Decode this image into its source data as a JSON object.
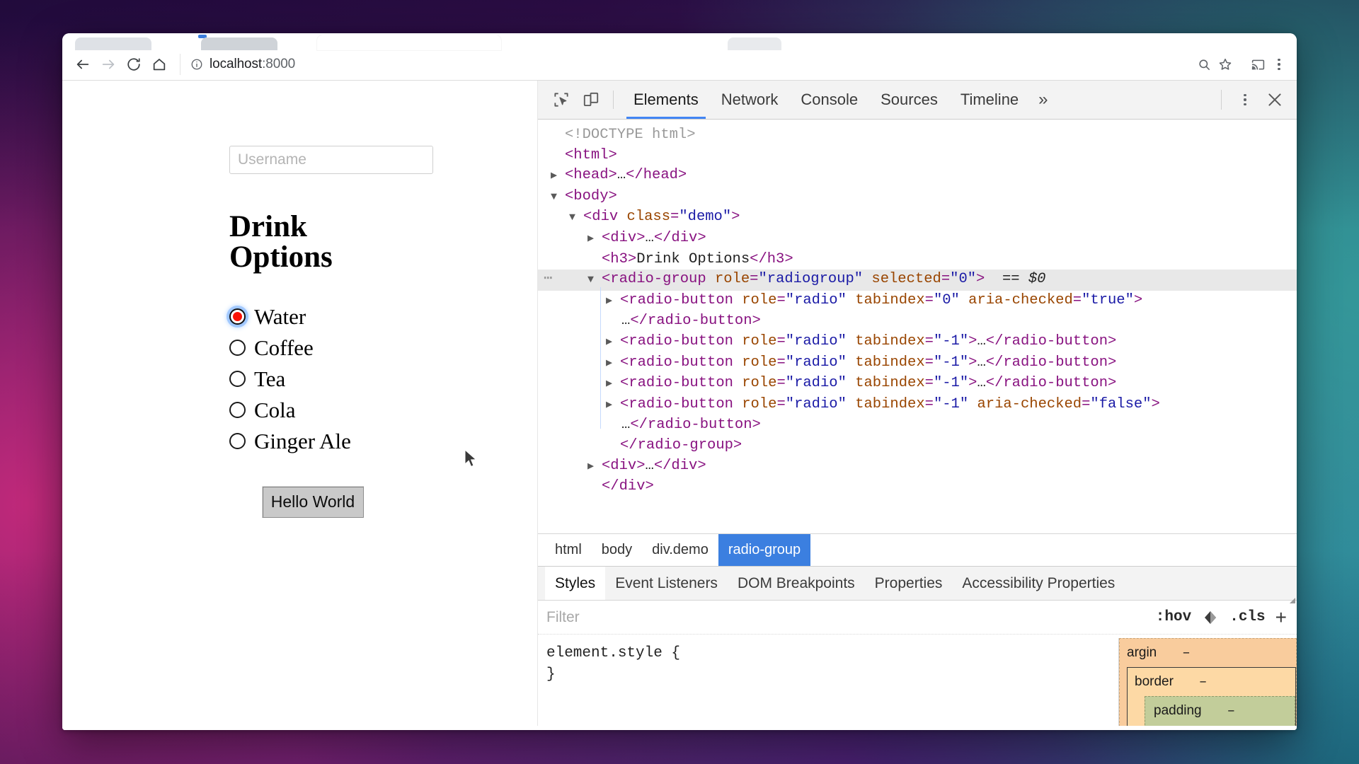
{
  "browser": {
    "url_host": "localhost",
    "url_port": ":8000",
    "back_icon": "back-arrow-icon",
    "forward_icon": "forward-arrow-icon",
    "reload_icon": "reload-icon",
    "home_icon": "home-icon",
    "info_icon": "site-info-icon",
    "zoom_icon": "zoom-icon",
    "star_icon": "bookmark-star-icon",
    "cast_icon": "cast-icon",
    "menu_icon": "browser-menu-icon"
  },
  "page": {
    "username_placeholder": "Username",
    "heading": "Drink Options",
    "options": [
      {
        "label": "Water",
        "selected": true
      },
      {
        "label": "Coffee",
        "selected": false
      },
      {
        "label": "Tea",
        "selected": false
      },
      {
        "label": "Cola",
        "selected": false
      },
      {
        "label": "Ginger Ale",
        "selected": false
      }
    ],
    "button_label": "Hello World"
  },
  "devtools": {
    "inspect_icon": "inspect-element-icon",
    "device_icon": "device-toolbar-icon",
    "tabs": [
      {
        "label": "Elements",
        "active": true
      },
      {
        "label": "Network",
        "active": false
      },
      {
        "label": "Console",
        "active": false
      },
      {
        "label": "Sources",
        "active": false
      },
      {
        "label": "Timeline",
        "active": false
      }
    ],
    "more_tabs_label": "»",
    "kebab_icon": "devtools-menu-icon",
    "close_icon": "close-devtools-icon",
    "dom": [
      {
        "indent": 0,
        "twisty": "none",
        "dots": false,
        "hl": false,
        "parts": [
          {
            "t": "doctype",
            "s": "<!DOCTYPE html>"
          }
        ]
      },
      {
        "indent": 0,
        "twisty": "none",
        "dots": false,
        "hl": false,
        "parts": [
          {
            "t": "tag",
            "s": "<html>"
          }
        ]
      },
      {
        "indent": 0,
        "twisty": "closed",
        "dots": false,
        "hl": false,
        "parts": [
          {
            "t": "tag",
            "s": "<head>"
          },
          {
            "t": "txt",
            "s": "…"
          },
          {
            "t": "tag",
            "s": "</head>"
          }
        ]
      },
      {
        "indent": 0,
        "twisty": "open",
        "dots": false,
        "hl": false,
        "parts": [
          {
            "t": "tag",
            "s": "<body>"
          }
        ]
      },
      {
        "indent": 1,
        "twisty": "open",
        "dots": false,
        "hl": false,
        "parts": [
          {
            "t": "tag",
            "s": "<div "
          },
          {
            "t": "attr",
            "s": "class"
          },
          {
            "t": "tag",
            "s": "="
          },
          {
            "t": "val",
            "s": "\"demo\""
          },
          {
            "t": "tag",
            "s": ">"
          }
        ]
      },
      {
        "indent": 2,
        "twisty": "closed",
        "dots": false,
        "hl": false,
        "parts": [
          {
            "t": "tag",
            "s": "<div>"
          },
          {
            "t": "txt",
            "s": "…"
          },
          {
            "t": "tag",
            "s": "</div>"
          }
        ]
      },
      {
        "indent": 2,
        "twisty": "none",
        "dots": false,
        "hl": false,
        "parts": [
          {
            "t": "tag",
            "s": "<h3>"
          },
          {
            "t": "txt",
            "s": "Drink Options"
          },
          {
            "t": "tag",
            "s": "</h3>"
          }
        ]
      },
      {
        "indent": 2,
        "twisty": "open",
        "dots": true,
        "hl": true,
        "parts": [
          {
            "t": "tag",
            "s": "<radio-group "
          },
          {
            "t": "attr",
            "s": "role"
          },
          {
            "t": "tag",
            "s": "="
          },
          {
            "t": "val",
            "s": "\"radiogroup\""
          },
          {
            "t": "tag",
            "s": " "
          },
          {
            "t": "attr",
            "s": "selected"
          },
          {
            "t": "tag",
            "s": "="
          },
          {
            "t": "val",
            "s": "\"0\""
          },
          {
            "t": "tag",
            "s": ">"
          },
          {
            "t": "txt",
            "s": "  == "
          },
          {
            "t": "dollar",
            "s": "$0"
          }
        ]
      },
      {
        "indent": 3,
        "twisty": "closed",
        "dots": false,
        "hl": false,
        "parts": [
          {
            "t": "tag",
            "s": "<radio-button "
          },
          {
            "t": "attr",
            "s": "role"
          },
          {
            "t": "tag",
            "s": "="
          },
          {
            "t": "val",
            "s": "\"radio\""
          },
          {
            "t": "tag",
            "s": " "
          },
          {
            "t": "attr",
            "s": "tabindex"
          },
          {
            "t": "tag",
            "s": "="
          },
          {
            "t": "val",
            "s": "\"0\""
          },
          {
            "t": "tag",
            "s": " "
          },
          {
            "t": "attr",
            "s": "aria-checked"
          },
          {
            "t": "tag",
            "s": "="
          },
          {
            "t": "val",
            "s": "\"true\""
          },
          {
            "t": "tag",
            "s": ">"
          }
        ]
      },
      {
        "indent": 3,
        "twisty": "none",
        "dots": false,
        "hl": false,
        "cont": true,
        "parts": [
          {
            "t": "txt",
            "s": "…"
          },
          {
            "t": "tag",
            "s": "</radio-button>"
          }
        ]
      },
      {
        "indent": 3,
        "twisty": "closed",
        "dots": false,
        "hl": false,
        "parts": [
          {
            "t": "tag",
            "s": "<radio-button "
          },
          {
            "t": "attr",
            "s": "role"
          },
          {
            "t": "tag",
            "s": "="
          },
          {
            "t": "val",
            "s": "\"radio\""
          },
          {
            "t": "tag",
            "s": " "
          },
          {
            "t": "attr",
            "s": "tabindex"
          },
          {
            "t": "tag",
            "s": "="
          },
          {
            "t": "val",
            "s": "\"-1\""
          },
          {
            "t": "tag",
            "s": ">"
          },
          {
            "t": "txt",
            "s": "…"
          },
          {
            "t": "tag",
            "s": "</radio-button>"
          }
        ]
      },
      {
        "indent": 3,
        "twisty": "closed",
        "dots": false,
        "hl": false,
        "parts": [
          {
            "t": "tag",
            "s": "<radio-button "
          },
          {
            "t": "attr",
            "s": "role"
          },
          {
            "t": "tag",
            "s": "="
          },
          {
            "t": "val",
            "s": "\"radio\""
          },
          {
            "t": "tag",
            "s": " "
          },
          {
            "t": "attr",
            "s": "tabindex"
          },
          {
            "t": "tag",
            "s": "="
          },
          {
            "t": "val",
            "s": "\"-1\""
          },
          {
            "t": "tag",
            "s": ">"
          },
          {
            "t": "txt",
            "s": "…"
          },
          {
            "t": "tag",
            "s": "</radio-button>"
          }
        ]
      },
      {
        "indent": 3,
        "twisty": "closed",
        "dots": false,
        "hl": false,
        "parts": [
          {
            "t": "tag",
            "s": "<radio-button "
          },
          {
            "t": "attr",
            "s": "role"
          },
          {
            "t": "tag",
            "s": "="
          },
          {
            "t": "val",
            "s": "\"radio\""
          },
          {
            "t": "tag",
            "s": " "
          },
          {
            "t": "attr",
            "s": "tabindex"
          },
          {
            "t": "tag",
            "s": "="
          },
          {
            "t": "val",
            "s": "\"-1\""
          },
          {
            "t": "tag",
            "s": ">"
          },
          {
            "t": "txt",
            "s": "…"
          },
          {
            "t": "tag",
            "s": "</radio-button>"
          }
        ]
      },
      {
        "indent": 3,
        "twisty": "closed",
        "dots": false,
        "hl": false,
        "parts": [
          {
            "t": "tag",
            "s": "<radio-button "
          },
          {
            "t": "attr",
            "s": "role"
          },
          {
            "t": "tag",
            "s": "="
          },
          {
            "t": "val",
            "s": "\"radio\""
          },
          {
            "t": "tag",
            "s": " "
          },
          {
            "t": "attr",
            "s": "tabindex"
          },
          {
            "t": "tag",
            "s": "="
          },
          {
            "t": "val",
            "s": "\"-1\""
          },
          {
            "t": "tag",
            "s": " "
          },
          {
            "t": "attr",
            "s": "aria-checked"
          },
          {
            "t": "tag",
            "s": "="
          },
          {
            "t": "val",
            "s": "\"false\""
          },
          {
            "t": "tag",
            "s": ">"
          }
        ]
      },
      {
        "indent": 3,
        "twisty": "none",
        "dots": false,
        "hl": false,
        "cont": true,
        "parts": [
          {
            "t": "txt",
            "s": "…"
          },
          {
            "t": "tag",
            "s": "</radio-button>"
          }
        ]
      },
      {
        "indent": 3,
        "twisty": "none",
        "dots": false,
        "hl": false,
        "parts": [
          {
            "t": "tag",
            "s": "</radio-group>"
          }
        ]
      },
      {
        "indent": 2,
        "twisty": "closed",
        "dots": false,
        "hl": false,
        "parts": [
          {
            "t": "tag",
            "s": "<div>"
          },
          {
            "t": "txt",
            "s": "…"
          },
          {
            "t": "tag",
            "s": "</div>"
          }
        ]
      },
      {
        "indent": 2,
        "twisty": "none",
        "dots": false,
        "hl": false,
        "parts": [
          {
            "t": "tag",
            "s": "</div>"
          }
        ]
      }
    ],
    "breadcrumbs": [
      {
        "label": "html",
        "active": false
      },
      {
        "label": "body",
        "active": false
      },
      {
        "label": "div.demo",
        "active": false
      },
      {
        "label": "radio-group",
        "active": true
      }
    ],
    "styles_tabs": [
      {
        "label": "Styles",
        "active": true
      },
      {
        "label": "Event Listeners",
        "active": false
      },
      {
        "label": "DOM Breakpoints",
        "active": false
      },
      {
        "label": "Properties",
        "active": false
      },
      {
        "label": "Accessibility Properties",
        "active": false
      }
    ],
    "filter_placeholder": "Filter",
    "hov_label": ":hov",
    "cls_label": ".cls",
    "plus_label": "+",
    "styles_rule_open": "element.style {",
    "styles_rule_close": "}",
    "box_model": {
      "margin_label": "argin",
      "margin_value": "–",
      "border_label": "border",
      "border_value": "–",
      "padding_label": "padding",
      "padding_value": "–"
    }
  },
  "colors": {
    "accent_blue": "#4285f4",
    "crumb_active": "#3b7fe0",
    "radio_red": "#fa1205",
    "tag_purple": "#881280",
    "attr_orange": "#994500",
    "value_blue": "#1a1aa6",
    "box_margin": "#f9cc9d",
    "box_border": "#fdd9a5",
    "box_padding": "#c2cd9a"
  }
}
